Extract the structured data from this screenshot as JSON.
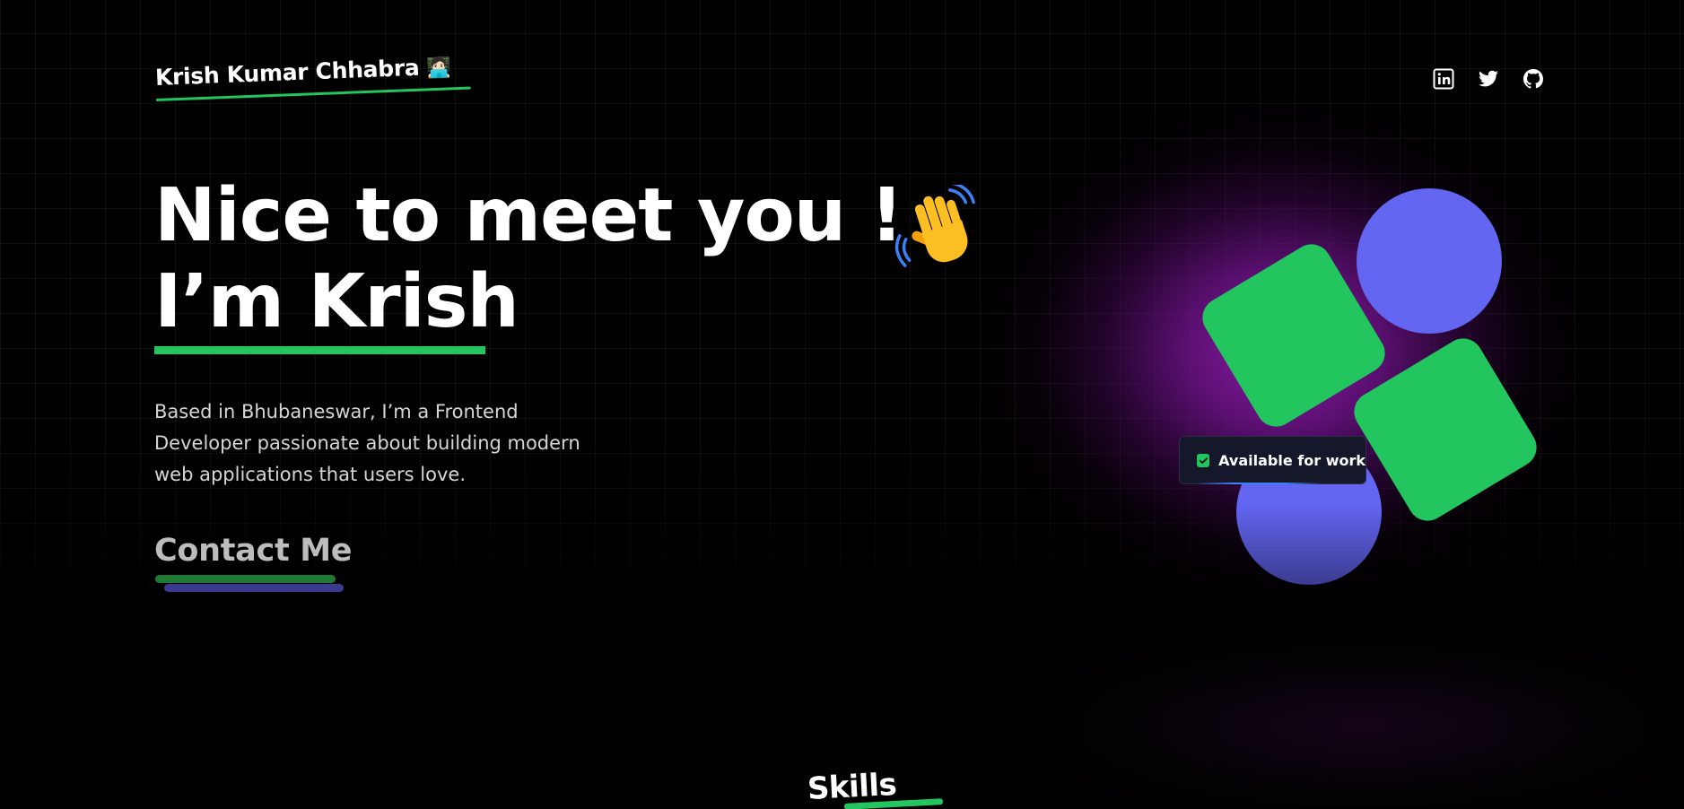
{
  "header": {
    "name": "Krish Kumar Chhabra",
    "name_emoji": "🧑🏻‍💻",
    "socials": [
      {
        "icon": "linkedin-icon"
      },
      {
        "icon": "twitter-icon"
      },
      {
        "icon": "github-icon"
      }
    ]
  },
  "hero": {
    "greeting": "Nice to meet you !",
    "wave_icon": "waving-hand-icon",
    "intro": "I’m Krish",
    "bio": "Based in Bhubaneswar, I’m a Frontend Developer passionate about building modern web applications that users love.",
    "contact_label": "Contact Me"
  },
  "badge": {
    "label": "Available for work",
    "checked": true
  },
  "sections": {
    "skills_title": "Skills"
  },
  "colors": {
    "background": "#000000",
    "accent_green": "#22c55e",
    "accent_indigo": "#6366f1",
    "glow_purple": "#961eb4",
    "text": "#ffffff"
  }
}
